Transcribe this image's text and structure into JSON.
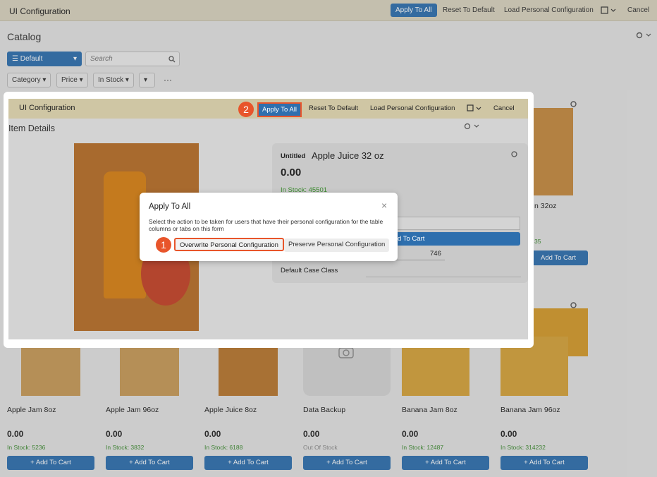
{
  "topbar": {
    "title": "UI Configuration",
    "apply_all": "Apply To All",
    "reset_default": "Reset To Default",
    "load_personal": "Load Personal Configuration",
    "cancel": "Cancel"
  },
  "catalog": {
    "title": "Catalog",
    "view_label": "Default",
    "search_placeholder": "Search",
    "filters": [
      "Category",
      "Price",
      "In Stock"
    ],
    "more": "···"
  },
  "products": [
    {
      "name": "Apple Jam 8oz",
      "price": "0.00",
      "stock": "In Stock: 5236",
      "add": "Add To Cart"
    },
    {
      "name": "Apple Jam 96oz",
      "price": "0.00",
      "stock": "In Stock: 3832",
      "add": "Add To Cart"
    },
    {
      "name": "Apple Juice 8oz",
      "price": "0.00",
      "stock": "In Stock: 6188",
      "add": "Add To Cart"
    },
    {
      "name": "Data Backup",
      "price": "0.00",
      "stock": "Out Of Stock",
      "add": "Add To Cart"
    },
    {
      "name": "Banana Jam 8oz",
      "price": "0.00",
      "stock": "In Stock: 12487",
      "add": "Add To Cart"
    },
    {
      "name": "Banana Jam 96oz",
      "price": "0.00",
      "stock": "In Stock: 314232",
      "add": "Add To Cart"
    }
  ],
  "right_card": {
    "name_partial": "n 32oz",
    "stock_partial": "35",
    "add": "Add To Cart"
  },
  "modal": {
    "bar_title": "UI Configuration",
    "apply_all": "Apply To All",
    "reset_default": "Reset To Default",
    "load_personal": "Load Personal Configuration",
    "cancel": "Cancel",
    "section_title": "Item Details",
    "item_prefix": "Untitled",
    "item_name": "Apple Juice 32 oz",
    "item_price": "0.00",
    "item_stock": "In Stock: 45501",
    "add_partial": "d To Cart",
    "qty_value": "746",
    "case_class_label": "Default Case Class"
  },
  "dialog": {
    "title": "Apply To All",
    "message": "Select the action to be taken for users that have their personal configuration for the table columns or tabs on this form",
    "overwrite": "Overwrite Personal Configuration",
    "preserve": "Preserve Personal Configuration",
    "close": "×"
  },
  "badges": {
    "one": "1",
    "two": "2"
  }
}
